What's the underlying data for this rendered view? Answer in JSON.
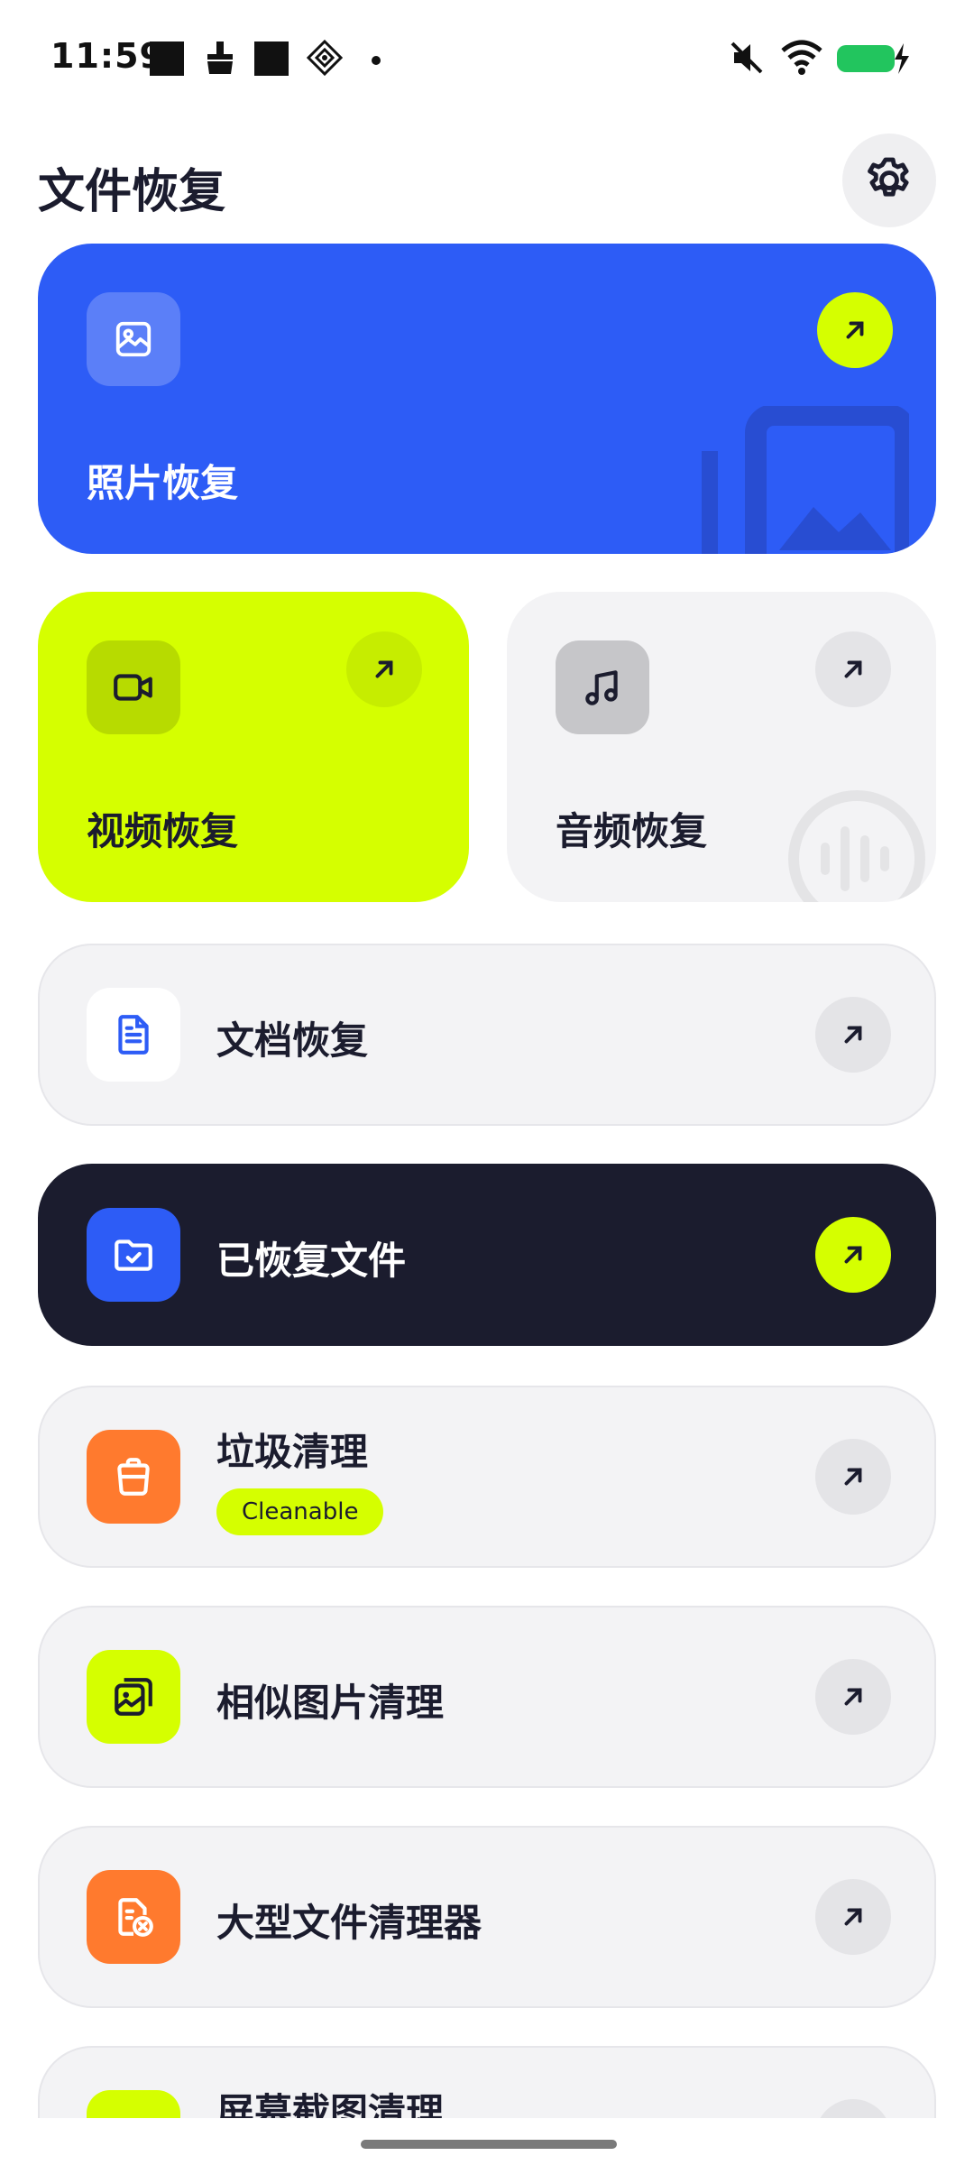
{
  "status_bar": {
    "time": "11:59",
    "icons": [
      "square-notification-icon",
      "broom-icon",
      "square-notification-icon",
      "diamond-grid-icon",
      "dot-icon",
      "mute-icon",
      "wifi-icon",
      "battery-charging-icon"
    ],
    "battery_color": "#22c55e"
  },
  "header": {
    "title": "文件恢复",
    "settings_icon": "gear-icon"
  },
  "colors": {
    "accent_blue": "#2d5cf6",
    "accent_lime": "#d5ff00",
    "dark": "#1b1c2e",
    "orange": "#ff7a2e",
    "card_gray": "#f3f3f5"
  },
  "cards": {
    "photo": {
      "label": "照片恢复",
      "icon": "image-icon",
      "arrow": "arrow-up-right-icon"
    },
    "video": {
      "label": "视频恢复",
      "icon": "video-camera-icon",
      "arrow": "arrow-up-right-icon"
    },
    "audio": {
      "label": "音频恢复",
      "icon": "music-note-icon",
      "arrow": "arrow-up-right-icon"
    }
  },
  "rows": [
    {
      "label": "文档恢复",
      "icon": "document-icon"
    },
    {
      "label": "已恢复文件",
      "icon": "folder-check-icon"
    },
    {
      "label": "垃圾清理",
      "icon": "trash-bag-icon",
      "badge": "Cleanable"
    },
    {
      "label": "相似图片清理",
      "icon": "similar-images-icon"
    },
    {
      "label": "大型文件清理器",
      "icon": "file-remove-icon"
    },
    {
      "label": "屏幕截图清理",
      "icon": "screenshot-icon"
    }
  ]
}
